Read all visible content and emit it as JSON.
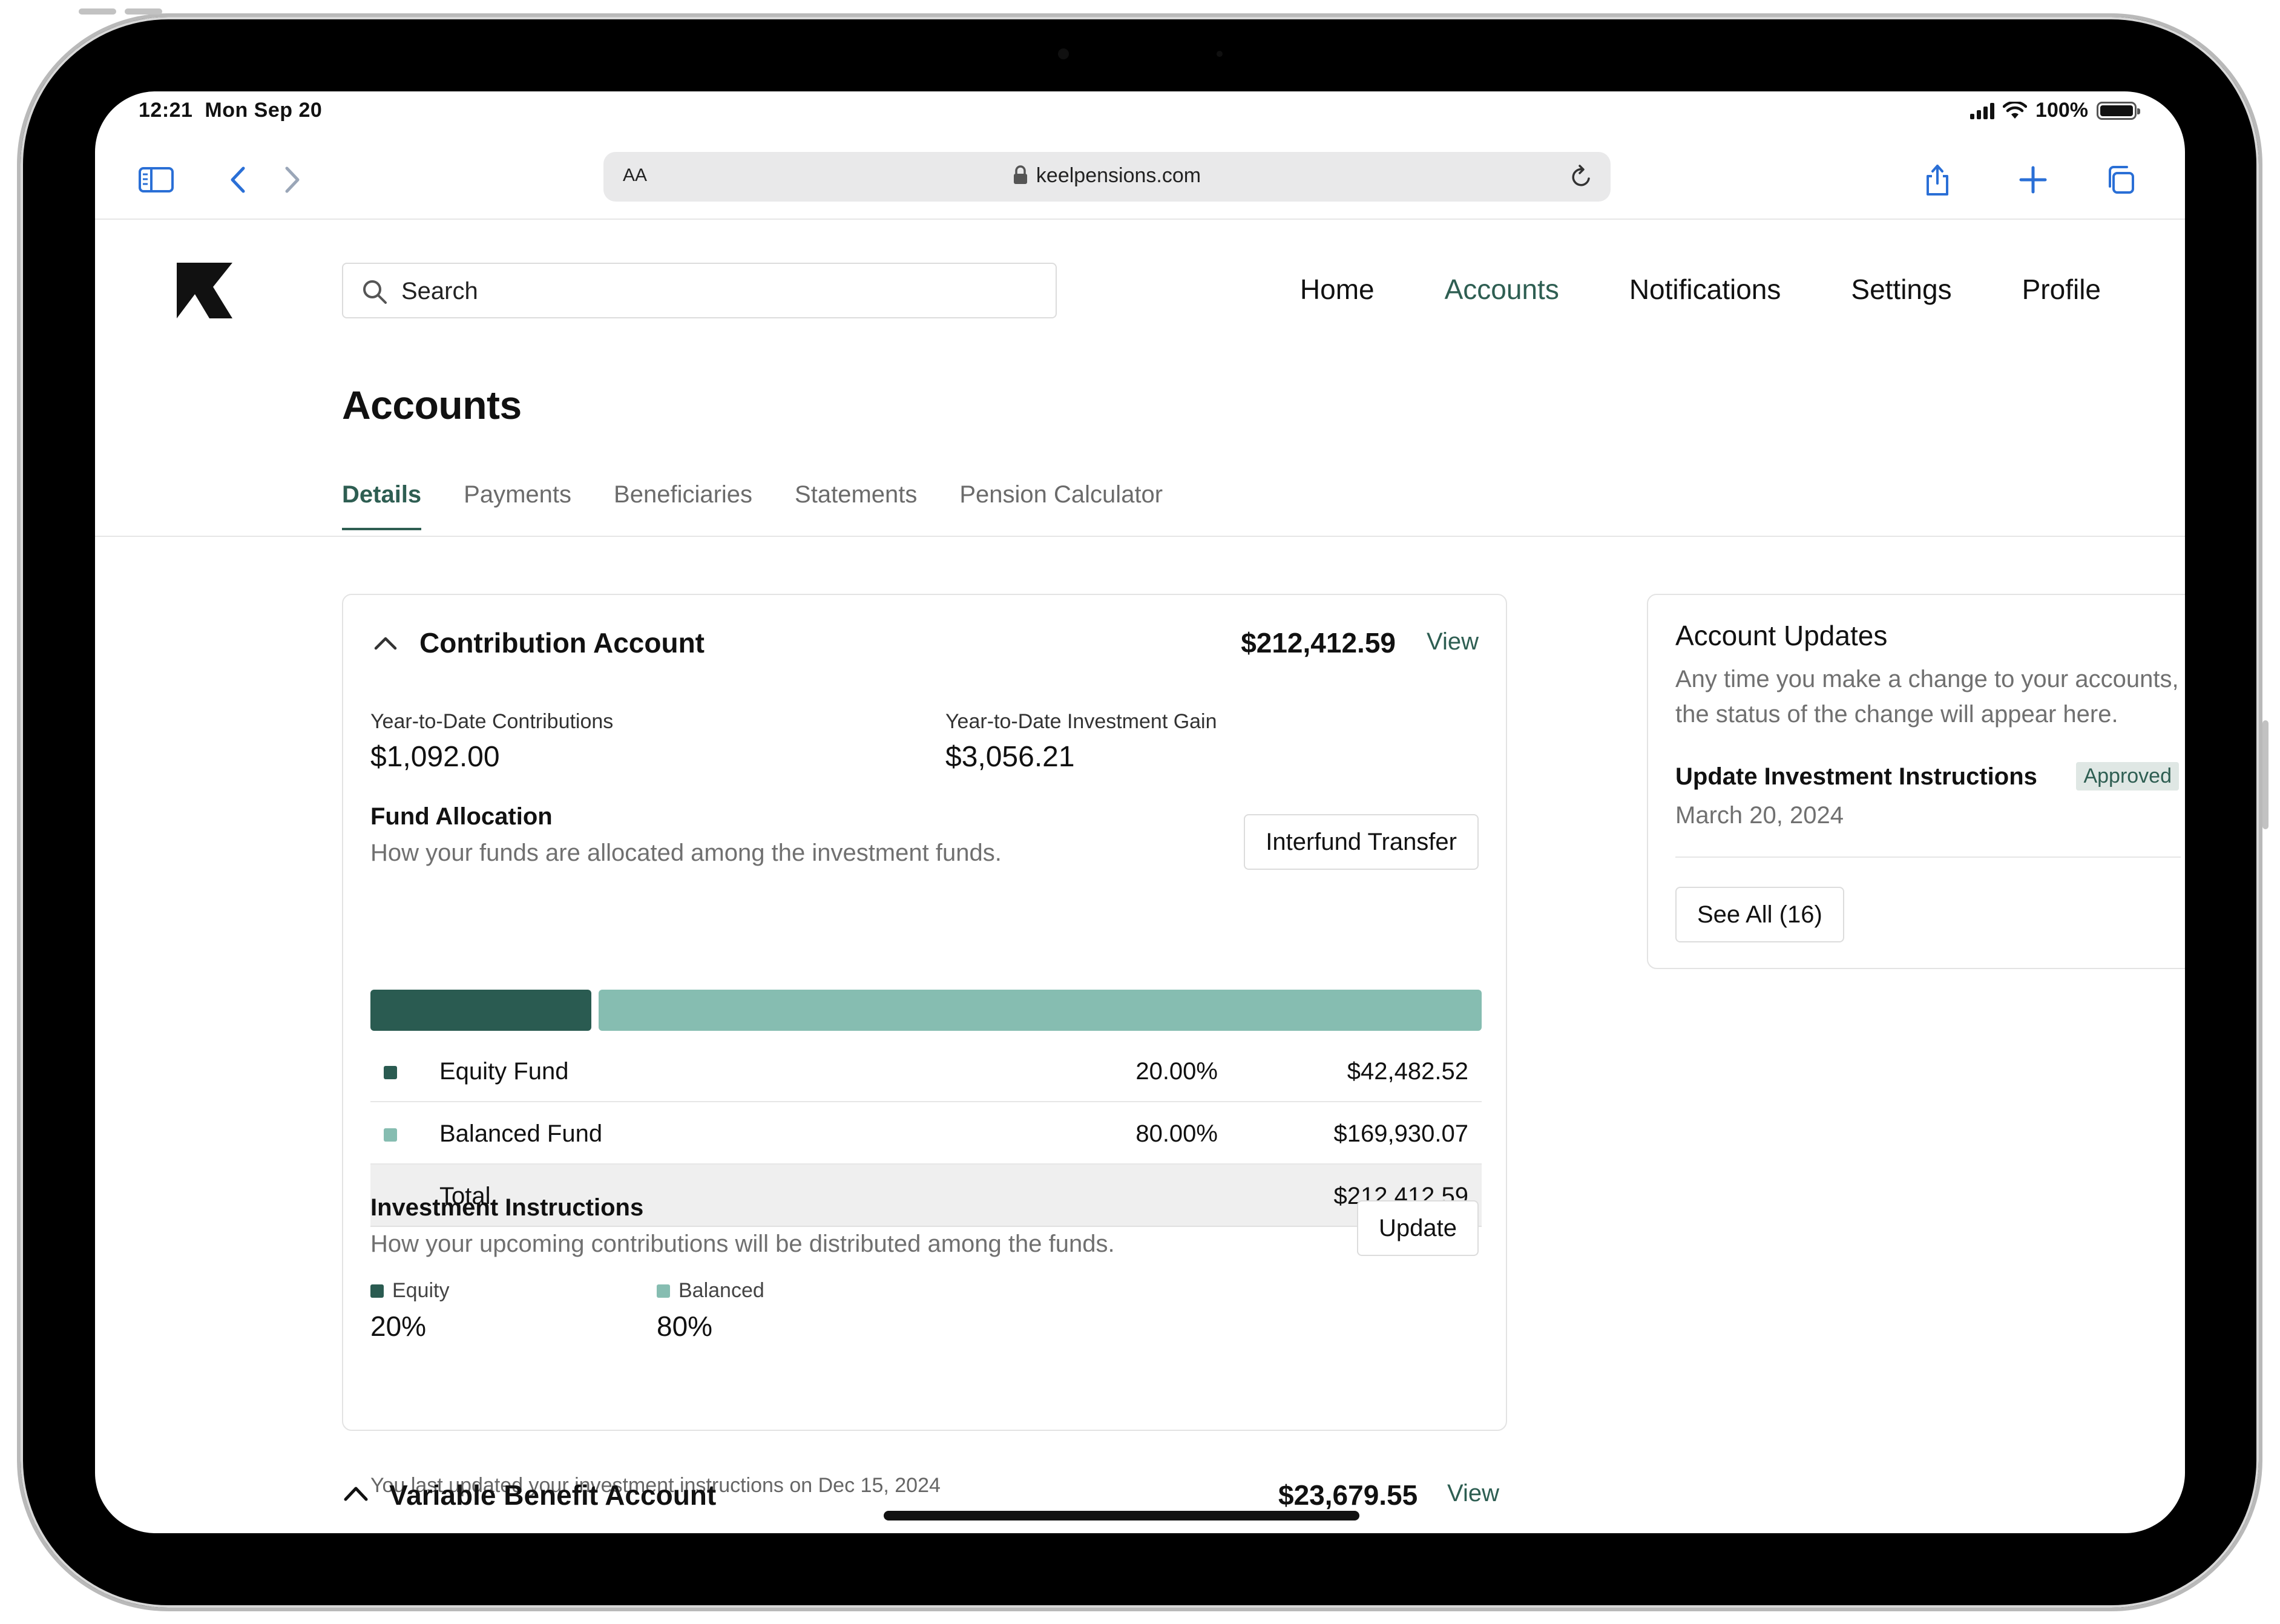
{
  "status_bar": {
    "time": "12:21",
    "date": "Mon Sep 20",
    "battery": "100%"
  },
  "browser": {
    "aa_label": "AA",
    "url": "keelpensions.com"
  },
  "search": {
    "placeholder": "Search"
  },
  "nav": {
    "items": [
      "Home",
      "Accounts",
      "Notifications",
      "Settings",
      "Profile"
    ],
    "active": "Accounts"
  },
  "page": {
    "title": "Accounts"
  },
  "tabs": {
    "items": [
      "Details",
      "Payments",
      "Beneficiaries",
      "Statements",
      "Pension Calculator"
    ],
    "active": "Details"
  },
  "contribution": {
    "title": "Contribution Account",
    "amount": "$212,412.59",
    "view_label": "View",
    "ytd_contrib_label": "Year-to-Date Contributions",
    "ytd_contrib_value": "$1,092.00",
    "ytd_gain_label": "Year-to-Date Investment Gain",
    "ytd_gain_value": "$3,056.21",
    "fund_alloc_title": "Fund Allocation",
    "fund_alloc_desc": "How your funds are allocated among the investment funds.",
    "interfund_label": "Interfund Transfer",
    "funds": [
      {
        "name": "Equity Fund",
        "percent": "20.00%",
        "amount": "$42,482.52",
        "share": 0.2,
        "color": "#2a5b51"
      },
      {
        "name": "Balanced Fund",
        "percent": "80.00%",
        "amount": "$169,930.07",
        "share": 0.8,
        "color": "#86bdb1"
      }
    ],
    "total_label": "Total",
    "total_amount": "$212,412.59",
    "instructions_title": "Investment Instructions",
    "instructions_desc": "How your upcoming contributions will be distributed among the funds.",
    "update_label": "Update",
    "instructions": [
      {
        "label": "Equity",
        "value": "20%"
      },
      {
        "label": "Balanced",
        "value": "80%"
      }
    ],
    "last_updated": "You last updated your investment instructions on Dec 15, 2024"
  },
  "updates": {
    "title": "Account Updates",
    "description": "Any time you make a change to your accounts, the status of the change will appear here.",
    "item_title": "Update Investment Instructions",
    "item_status": "Approved",
    "item_date": "March 20, 2024",
    "see_all_label": "See All (16)"
  },
  "variable_benefit": {
    "title": "Variable Benefit Account",
    "amount": "$23,679.55",
    "view_label": "View"
  },
  "colors": {
    "accent": "#2e5e52",
    "equity": "#2a5b51",
    "balanced": "#86bdb1",
    "safari_blue": "#2a6fd6"
  }
}
